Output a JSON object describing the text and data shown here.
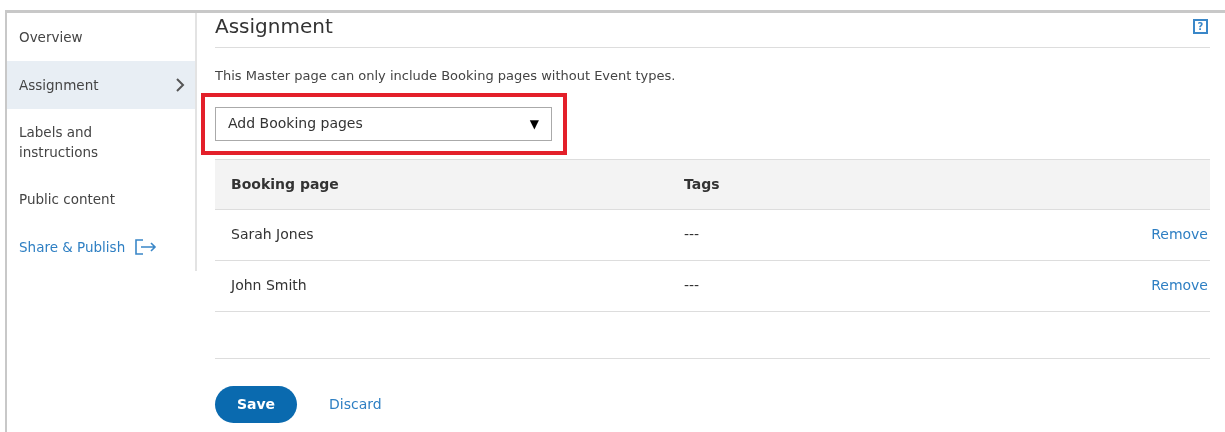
{
  "sidebar": {
    "items": [
      {
        "label": "Overview",
        "selected": false,
        "kind": "item"
      },
      {
        "label": "Assignment",
        "selected": true,
        "kind": "item"
      },
      {
        "label": "Labels and instructions",
        "selected": false,
        "kind": "item"
      },
      {
        "label": "Public content",
        "selected": false,
        "kind": "item"
      },
      {
        "label": "Share & Publish",
        "selected": false,
        "kind": "link"
      }
    ]
  },
  "main": {
    "title": "Assignment",
    "help": "?",
    "description": "This Master page can only include Booking pages without Event types.",
    "dropdown": {
      "value": "Add Booking pages",
      "caret": "▼"
    },
    "table": {
      "columns": [
        "Booking page",
        "Tags"
      ],
      "rows": [
        {
          "name": "Sarah Jones",
          "tags": "---",
          "action": "Remove"
        },
        {
          "name": "John Smith",
          "tags": "---",
          "action": "Remove"
        }
      ]
    },
    "buttons": {
      "save": "Save",
      "discard": "Discard"
    }
  }
}
